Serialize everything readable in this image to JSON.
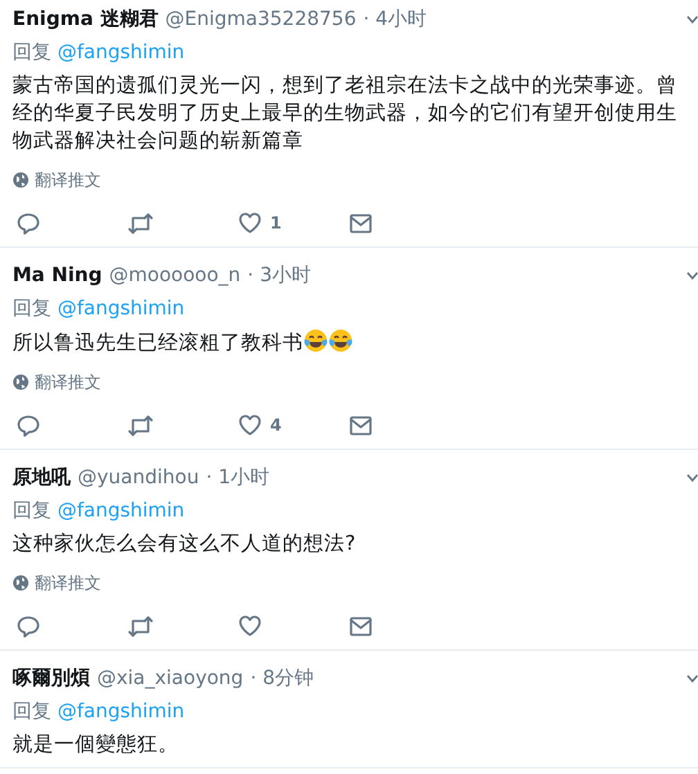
{
  "tweets": [
    {
      "name": "Enigma 迷糊君",
      "handle": "@Enigma35228756",
      "time": "· 4小时",
      "reply_prefix": "回复",
      "reply_to": "@fangshimin",
      "text": "蒙古帝国的遗孤们灵光一闪，想到了老祖宗在法卡之战中的光荣事迹。曾经的华夏子民发明了历史上最早的生物武器，如今的它们有望开创使用生物武器解决社会问题的崭新篇章",
      "translate": "翻译推文",
      "likes": "1"
    },
    {
      "name": "Ma Ning",
      "handle": "@moooooo_n",
      "time": "· 3小时",
      "reply_prefix": "回复",
      "reply_to": "@fangshimin",
      "text": "所以鲁迅先生已经滚粗了教科书",
      "trailing_icons": [
        {
          "kind": "tears-of-joy"
        },
        {
          "kind": "tears-of-joy"
        }
      ],
      "translate": "翻译推文",
      "likes": "4"
    },
    {
      "name": "原地吼",
      "handle": "@yuandihou",
      "time": "· 1小时",
      "reply_prefix": "回复",
      "reply_to": "@fangshimin",
      "text": "这种家伙怎么会有这么不人道的想法?",
      "translate": "翻译推文"
    },
    {
      "name": "啄爾別煩",
      "handle": "@xia_xiaoyong",
      "time": "· 8分钟",
      "reply_prefix": "回复",
      "reply_to": "@fangshimin",
      "text": "就是一個變態狂。"
    }
  ]
}
